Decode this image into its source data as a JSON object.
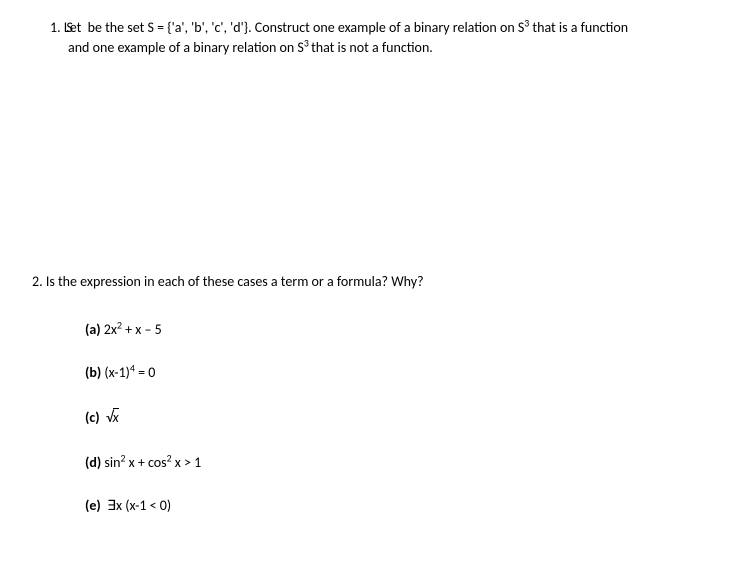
{
  "q1": {
    "number": "1.",
    "line1_pre": "Let ",
    "line1_S": "S",
    "line1_post": " be the set S = {'a', 'b', 'c', 'd'}. Construct one example of a binary relation on S",
    "line1_sup": "3",
    "line1_end": " that is a function",
    "line2_pre": "and one example of a binary relation on S",
    "line2_sup": "3 ",
    "line2_end": "that is not a function."
  },
  "q2": {
    "number": "2.",
    "intro": "Is the expression in each of these cases a term or a formula? Why?",
    "items": {
      "a": {
        "label": "(a)",
        "pre": "  2x",
        "sup1": "2",
        "post": " + x – 5"
      },
      "b": {
        "label": "(b)",
        "pre": "  (x-1)",
        "sup1": "4",
        "post": " = 0"
      },
      "c": {
        "label": "(c)",
        "sqrt_x": "x"
      },
      "d": {
        "label": "(d)",
        "pre": "  sin",
        "sup1": "2",
        "mid": " x + cos",
        "sup2": "2",
        "post": " x > 1"
      },
      "e": {
        "label": "(e)",
        "exists": "∃",
        "post": "x (x-1 < 0)"
      }
    }
  }
}
